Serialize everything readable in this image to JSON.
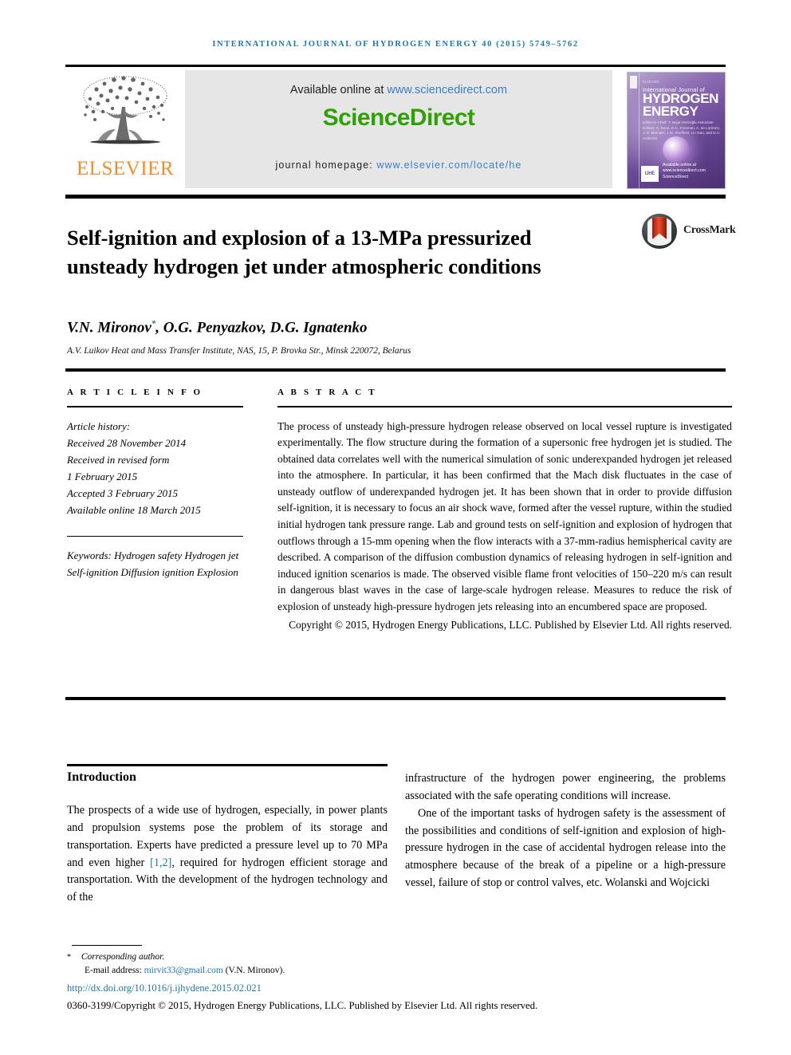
{
  "running_head": "International Journal of Hydrogen Energy 40 (2015) 5749–5762",
  "masthead": {
    "elsevier_wordmark": "ELSEVIER",
    "available_prefix": "Available online at ",
    "available_link": "www.sciencedirect.com",
    "sciencedirect_logo": "ScienceDirect",
    "homepage_prefix": "journal homepage: ",
    "homepage_link": "www.elsevier.com/locate/he",
    "cover": {
      "top_line": "ELSEVIER",
      "kicker": "International Journal of",
      "line1": "HYDROGEN",
      "line2": "ENERGY",
      "editors": "Editor-in-Chief: T. Nejat Veziroğlu\nAssociate Editors: S. Dunn, D.C. Freeman, A. de Lorenzo, A.G. Mamalis, J.W. Sheffield, Lin Gao, and D.A. Ambrosh",
      "badge": "IJHE",
      "sd_note": "Available online at www.sciencedirect.com\nScienceDirect"
    }
  },
  "article": {
    "title": "Self-ignition and explosion of a 13-MPa pressurized unsteady hydrogen jet under atmospheric conditions",
    "crossmark_label": "CrossMark",
    "authors": "V.N. Mironov, O.G. Penyazkov, D.G. Ignatenko",
    "authors_corresponding_marker": "*",
    "affiliation": "A.V. Luikov Heat and Mass Transfer Institute, NAS, 15, P. Brovka Str., Minsk 220072, Belarus"
  },
  "article_info": {
    "heading": "A R T I C L E   I N F O",
    "history_label": "Article history:",
    "history": [
      "Received 28 November 2014",
      "Received in revised form",
      "1 February 2015",
      "Accepted 3 February 2015",
      "Available online 18 March 2015"
    ],
    "keywords_label": "Keywords:",
    "keywords": [
      "Hydrogen safety",
      "Hydrogen jet",
      "Self-ignition",
      "Diffusion ignition",
      "Explosion"
    ]
  },
  "abstract": {
    "heading": "A B S T R A C T",
    "text": "The process of unsteady high-pressure hydrogen release observed on local vessel rupture is investigated experimentally. The flow structure during the formation of a supersonic free hydrogen jet is studied. The obtained data correlates well with the numerical simulation of sonic underexpanded hydrogen jet released into the atmosphere. In particular, it has been confirmed that the Mach disk fluctuates in the case of unsteady outflow of underexpanded hydrogen jet. It has been shown that in order to provide diffusion self-ignition, it is necessary to focus an air shock wave, formed after the vessel rupture, within the studied initial hydrogen tank pressure range. Lab and ground tests on self-ignition and explosion of hydrogen that outflows through a 15-mm opening when the flow interacts with a 37-mm-radius hemispherical cavity are described. A comparison of the diffusion combustion dynamics of releasing hydrogen in self-ignition and induced ignition scenarios is made. The observed visible flame front velocities of 150–220 m/s can result in dangerous blast waves in the case of large-scale hydrogen release. Measures to reduce the risk of explosion of unsteady high-pressure hydrogen jets releasing into an encumbered space are proposed.",
    "copyright": "Copyright © 2015, Hydrogen Energy Publications, LLC. Published by Elsevier Ltd. All rights reserved."
  },
  "body": {
    "section_heading": "Introduction",
    "left_paragraph_1": "The prospects of a wide use of hydrogen, especially, in power plants and propulsion systems pose the problem of its storage and transportation. Experts have predicted a pressure level up to 70 MPa and even higher ",
    "left_citation": "[1,2]",
    "left_paragraph_1_cont": ", required for hydrogen efficient storage and transportation. With the development of the hydrogen technology and of the",
    "right_paragraph_1": "infrastructure of the hydrogen power engineering, the problems associated with the safe operating conditions will increase.",
    "right_paragraph_2": "One of the important tasks of hydrogen safety is the assessment of the possibilities and conditions of self-ignition and explosion of high-pressure hydrogen in the case of accidental hydrogen release into the atmosphere because of the break of a pipeline or a high-pressure vessel, failure of stop or control valves, etc. Wolanski and Wojcicki"
  },
  "footer": {
    "corresponding_marker": "*",
    "corresponding_text": "Corresponding author.",
    "email_label": "E-mail address: ",
    "email": "mirvit33@gmail.com",
    "email_suffix": " (V.N. Mironov).",
    "doi": "http://dx.doi.org/10.1016/j.ijhydene.2015.02.021",
    "issn_line": "0360-3199/Copyright © 2015, Hydrogen Energy Publications, LLC. Published by Elsevier Ltd. All rights reserved."
  },
  "colors": {
    "journal_blue": "#1b78a8",
    "sciencedirect_green": "#2ea105",
    "elsevier_orange": "#f28c28",
    "link_blue": "#3a7fc1",
    "band_gray": "#e6e6e6"
  }
}
